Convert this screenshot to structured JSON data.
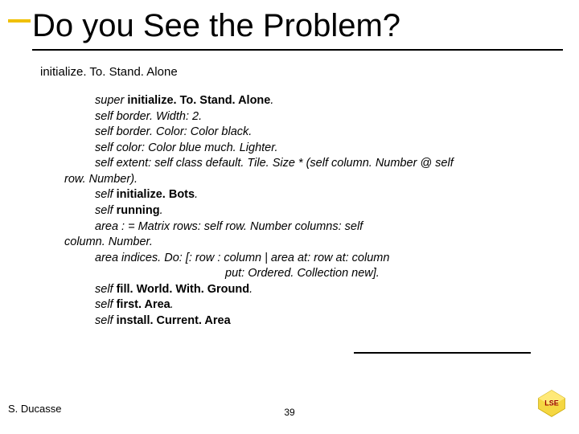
{
  "title": "Do you See the Problem?",
  "subhead": "initialize. To. Stand. Alone",
  "code": {
    "l1a": "super ",
    "l1b": "initialize. To. Stand. Alone",
    "l1c": ".",
    "l2a": "self border. Width: 2.",
    "l3a": "self border. Color: Color black.",
    "l4a": "self color: Color blue much. Lighter.",
    "l5a": "self extent: self class default. Tile. Size * (self column. Number @ self",
    "l5b": "row. Number).",
    "l6a": "self ",
    "l6b": "initialize. Bots",
    "l6c": ".",
    "l7a": "self ",
    "l7b": "running",
    "l7c": ".",
    "l8a": "area : = Matrix rows: self row. Number columns: self",
    "l8b": "column. Number.",
    "l9a": "area indices. Do: [: row : column | area at: row at: column",
    "l9b": "put: Ordered. Collection new].",
    "l10a": "self ",
    "l10b": "fill. World. With. Ground",
    "l10c": ".",
    "l11a": "self ",
    "l11b": "first. Area",
    "l11c": ".",
    "l12a": "self ",
    "l12b": "install. Current. Area"
  },
  "author": "S. Ducasse",
  "page": "39",
  "logo_text": "LSE"
}
